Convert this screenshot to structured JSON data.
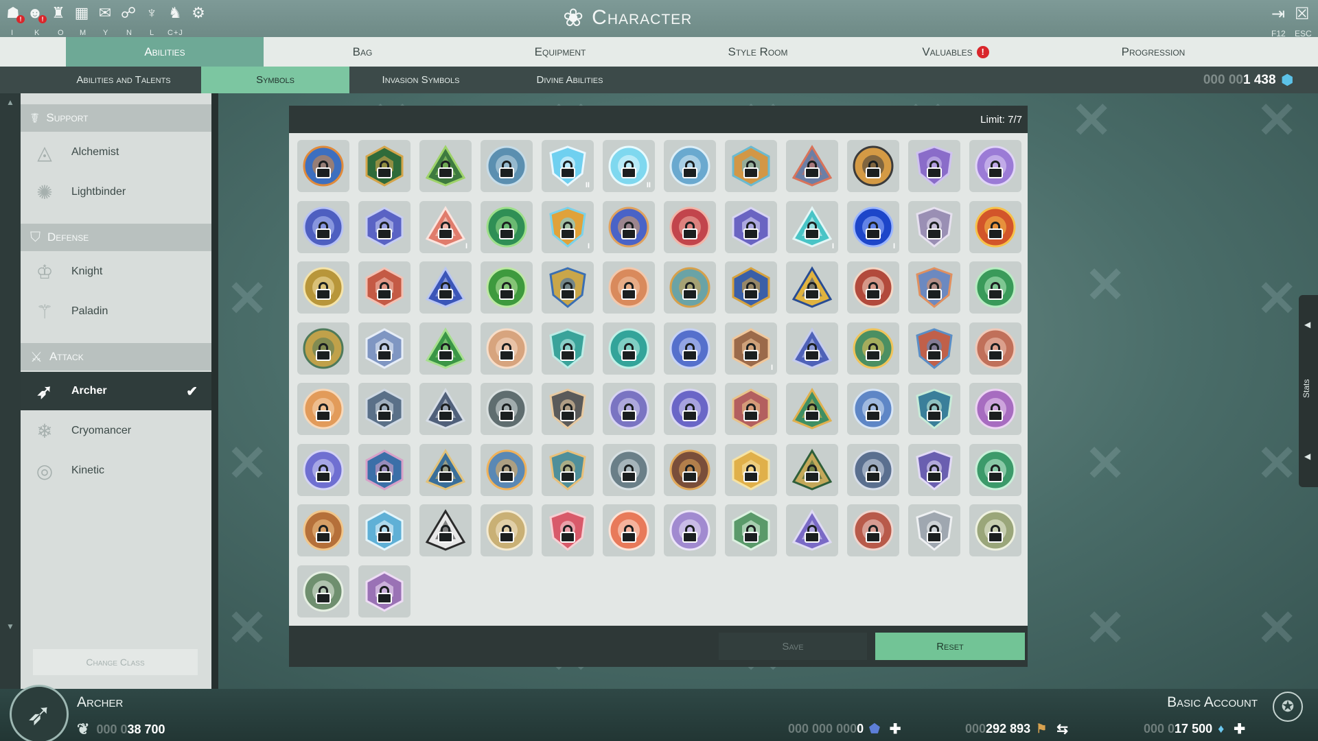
{
  "window": {
    "title": "Character",
    "hotkeys": [
      {
        "icon": "character-icon",
        "key": "I",
        "alert": true
      },
      {
        "icon": "guild-icon",
        "key": "K",
        "alert": true
      },
      {
        "icon": "bestiary-icon",
        "key": "O"
      },
      {
        "icon": "map-icon",
        "key": "M"
      },
      {
        "icon": "chat-icon",
        "key": "Y"
      },
      {
        "icon": "handshake-icon",
        "key": "N"
      },
      {
        "icon": "emblem-icon",
        "key": "L"
      },
      {
        "icon": "pegasus-icon",
        "key": "C+J"
      },
      {
        "icon": "settings-icon",
        "key": ""
      }
    ],
    "exit_key": "F12",
    "close_key": "ESC"
  },
  "main_tabs": [
    {
      "label": "Abilities",
      "active": true
    },
    {
      "label": "Bag"
    },
    {
      "label": "Equipment"
    },
    {
      "label": "Style Room"
    },
    {
      "label": "Valuables",
      "badge": "!"
    },
    {
      "label": "Progression"
    }
  ],
  "sub_tabs": [
    {
      "label": "Abilities and Talents"
    },
    {
      "label": "Symbols",
      "active": true
    },
    {
      "label": "Invasion Symbols"
    },
    {
      "label": "Divine Abilities"
    }
  ],
  "top_currency": {
    "dim": "000 00",
    "value": "1 438",
    "icon": "crystal-icon"
  },
  "classes": {
    "support": {
      "label": "Support",
      "items": [
        "Alchemist",
        "Lightbinder"
      ]
    },
    "defense": {
      "label": "Defense",
      "items": [
        "Knight",
        "Paladin"
      ]
    },
    "attack": {
      "label": "Attack",
      "items": [
        "Archer",
        "Cryomancer",
        "Kinetic"
      ],
      "selected": "Archer"
    }
  },
  "change_class": "Change Class",
  "symbols": {
    "limit": "Limit: 7/7",
    "rank_marks": [
      "II",
      "II",
      "I",
      "I",
      "I",
      "I",
      "I"
    ],
    "save": "Save",
    "reset": "Reset"
  },
  "stats_tab": "Stats",
  "footer": {
    "class_name": "Archer",
    "account": "Basic Account",
    "currency_left": {
      "dim": "000 0",
      "value": "38 700"
    },
    "currency_1": {
      "dim": "000 000 000",
      "value": "0"
    },
    "currency_2": {
      "dim": "000 ",
      "value": "292 893"
    },
    "currency_3": {
      "dim": "000 0",
      "value": "17 500"
    }
  }
}
